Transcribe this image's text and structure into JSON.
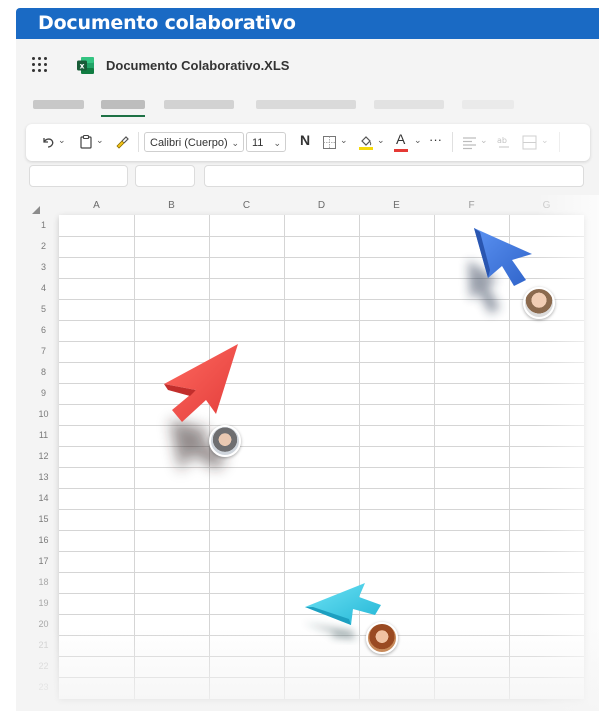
{
  "window": {
    "title": "Documento colaborativo",
    "title_bar_color": "#1a6ac4"
  },
  "app_bar": {
    "launcher_icon": "waffle-icon",
    "file_icon": "excel-icon",
    "file_name": "Documento Colaborativo.XLS"
  },
  "ribbon": {
    "undo_icon": "undo-icon",
    "paste_icon": "clipboard-icon",
    "format_painter_icon": "brush-icon",
    "font_name": "Calibri (Cuerpo)",
    "font_size": "11",
    "bold_label": "N",
    "borders_icon": "borders-icon",
    "fill_icon": "fill-color-icon",
    "font_color_label": "A",
    "more_label": "···",
    "align_icon": "align-icon",
    "wrap_icon": "wrap-text-icon",
    "merge_icon": "merge-icon",
    "fill_color": "#f5d90a",
    "font_color": "#e53935"
  },
  "grid": {
    "columns": [
      "A",
      "B",
      "C",
      "D",
      "E",
      "F",
      "G"
    ],
    "rows": [
      "1",
      "2",
      "3",
      "4",
      "5",
      "6",
      "7",
      "8",
      "9",
      "10",
      "11",
      "12",
      "13",
      "14",
      "15",
      "16",
      "17",
      "18",
      "19",
      "20",
      "21",
      "22",
      "23"
    ]
  },
  "collaborators": [
    {
      "name": "blue-user",
      "cursor_color": "#3d7be8"
    },
    {
      "name": "red-user",
      "cursor_color": "#f0504c"
    },
    {
      "name": "cyan-user",
      "cursor_color": "#3fd0ea"
    }
  ]
}
